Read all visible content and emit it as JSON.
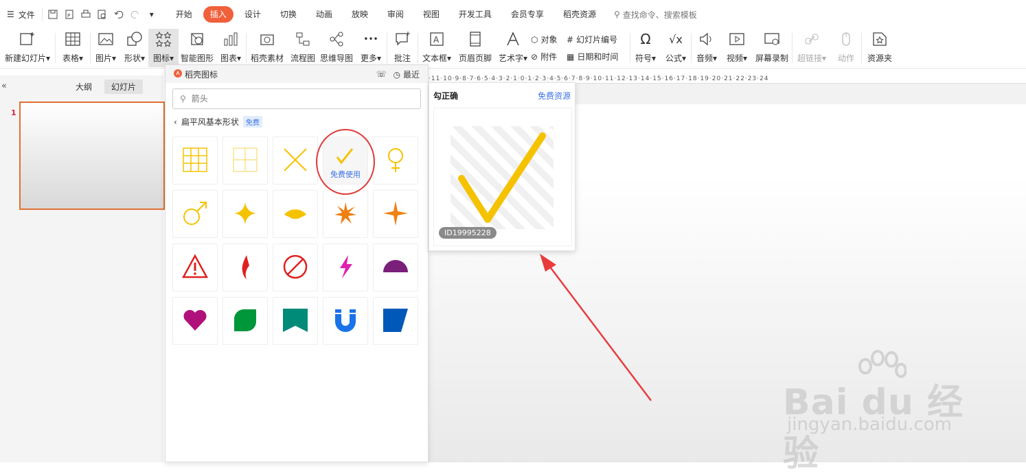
{
  "menubar": {
    "file_label": "文件",
    "tabs": [
      "开始",
      "插入",
      "设计",
      "切换",
      "动画",
      "放映",
      "审阅",
      "视图",
      "开发工具",
      "会员专享",
      "稻壳资源"
    ],
    "active_tab": "插入",
    "search_placeholder": "查找命令、搜索模板"
  },
  "ribbon": {
    "new_slide": "新建幻灯片",
    "table": "表格",
    "picture": "图片",
    "shape": "形状",
    "icon": "图标",
    "smartart": "智能图形",
    "chart": "图表",
    "material": "稻壳素材",
    "flowchart": "流程图",
    "mindmap": "思维导图",
    "more": "更多",
    "comment": "批注",
    "textbox": "文本框",
    "header_footer": "页眉页脚",
    "wordart": "艺术字",
    "object": "对象",
    "attachment": "附件",
    "slide_number": "幻灯片编号",
    "datetime": "日期和时间",
    "symbol": "符号",
    "formula": "公式",
    "audio": "音频",
    "video": "视频",
    "screen_record": "屏幕录制",
    "hyperlink": "超链接",
    "action": "动作",
    "resource": "资源夹"
  },
  "left_panel": {
    "tab_outline": "大纲",
    "tab_slides": "幻灯片",
    "slide_number": "1"
  },
  "icon_panel": {
    "title": "稻壳图标",
    "recent": "最近",
    "search_value": "",
    "search_placeholder": "箭头",
    "category": "扁平风基本形状",
    "category_badge": "免费",
    "hover_label": "免费使用"
  },
  "preview": {
    "title": "勾正确",
    "link": "免费资源",
    "id": "ID19995228"
  },
  "ruler_text": "·11·10·9·8·7·6·5·4·3·2·1·0·1·2·3·4·5·6·7·8·9·10·11·12·13·14·15·16·17·18·19·20·21·22·23·24",
  "watermark": {
    "line1": "Bai du 经验",
    "line2": "jingyan.baidu.com"
  },
  "colors": {
    "accent": "#f0603b",
    "link": "#3b72e6",
    "yellow": "#f5c200",
    "orange": "#f08010",
    "red": "#e02020",
    "magenta": "#c0108a",
    "purple": "#7a1f7a",
    "green": "#00963a",
    "teal": "#008a78",
    "blue": "#1a73e8",
    "darkblue": "#0059b8",
    "annotation": "#e03a3a"
  },
  "icons": [
    "grid-icon",
    "grid-thin-icon",
    "cross-icon",
    "check-icon",
    "female-icon",
    "male-icon",
    "sparkle-icon",
    "fan-icon",
    "starburst-icon",
    "star4-icon",
    "warning-icon",
    "flame-icon",
    "no-entry-icon",
    "lightning-icon",
    "semicircle-icon",
    "heart-icon",
    "leaf-icon",
    "bookmark-icon",
    "magnet-icon",
    "parallelogram-icon"
  ]
}
